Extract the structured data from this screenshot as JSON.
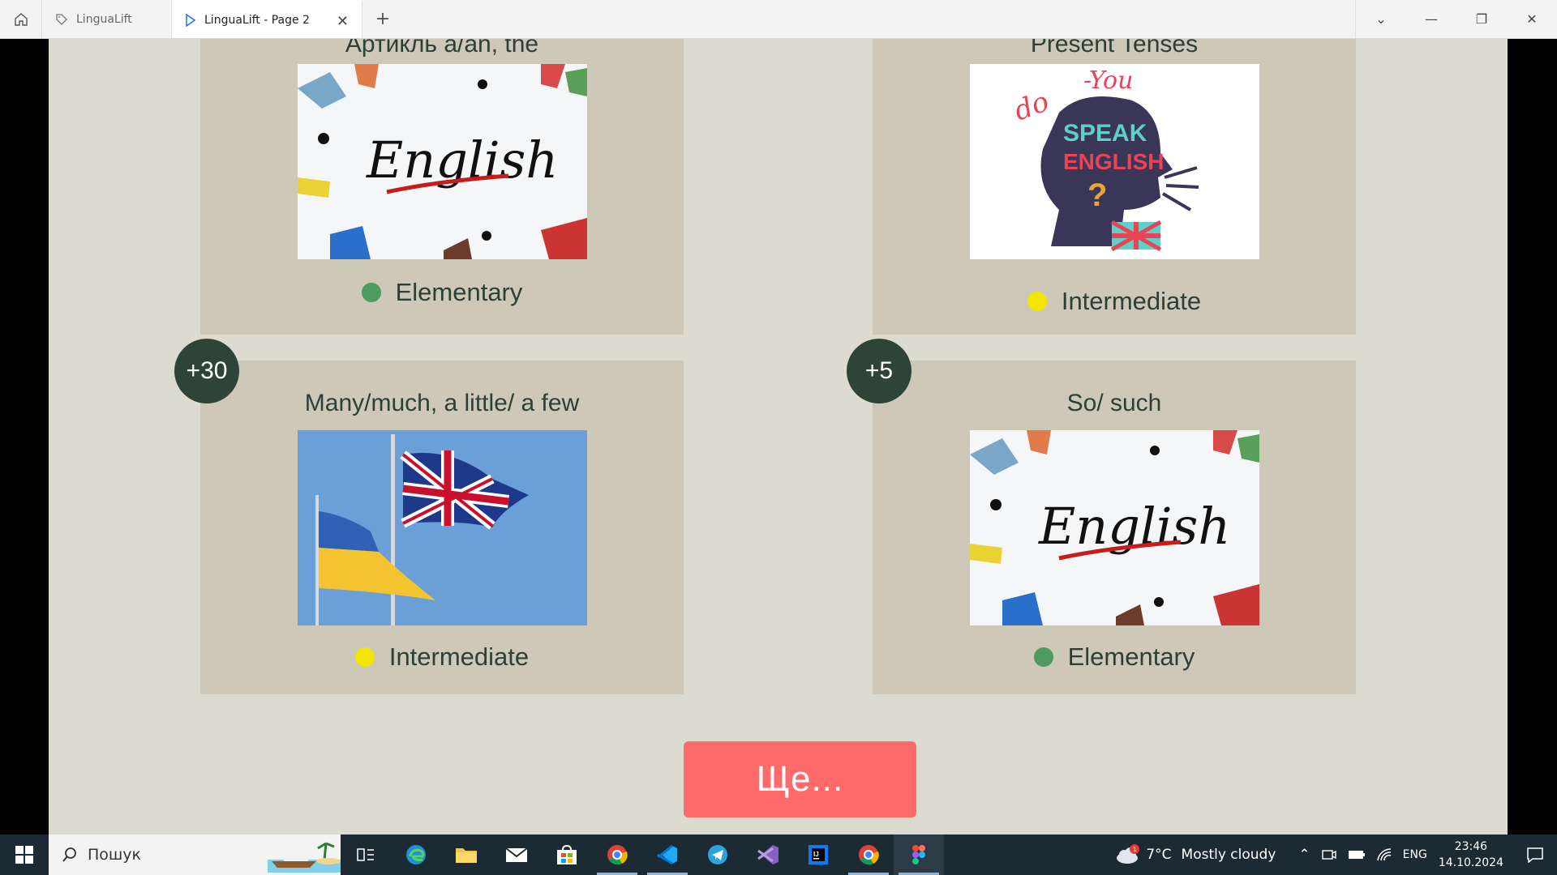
{
  "browser": {
    "tabs": [
      {
        "label": "LinguaLift",
        "active": false
      },
      {
        "label": "LinguaLift - Page 2",
        "active": true
      }
    ]
  },
  "cards": [
    {
      "title": "Артикль a/an, the",
      "level": "Elementary",
      "level_color": "#4e9a5f",
      "badge": "",
      "image": "english-hands"
    },
    {
      "title": "Present Tenses",
      "level": "Intermediate",
      "level_color": "#f2e600",
      "badge": "",
      "image": "do-you-speak-english"
    },
    {
      "title": "Many/much, a little/ a few",
      "level": "Intermediate",
      "level_color": "#f2e600",
      "badge": "+30",
      "image": "uk-ukraine-flags"
    },
    {
      "title": "So/ such",
      "level": "Elementary",
      "level_color": "#4e9a5f",
      "badge": "+5",
      "image": "english-hands"
    }
  ],
  "more_button": {
    "label": "Ще..."
  },
  "taskbar": {
    "search_placeholder": "Пошук",
    "apps": [
      "task-view",
      "edge",
      "file-explorer",
      "mail",
      "store",
      "chrome",
      "vscode",
      "telegram",
      "visual-studio",
      "intellij",
      "chrome-profile",
      "figma"
    ],
    "weather": {
      "temp": "7°C",
      "condition": "Mostly cloudy",
      "alert_count": "1"
    },
    "lang": "ENG",
    "time": "23:46",
    "date": "14.10.2024"
  }
}
